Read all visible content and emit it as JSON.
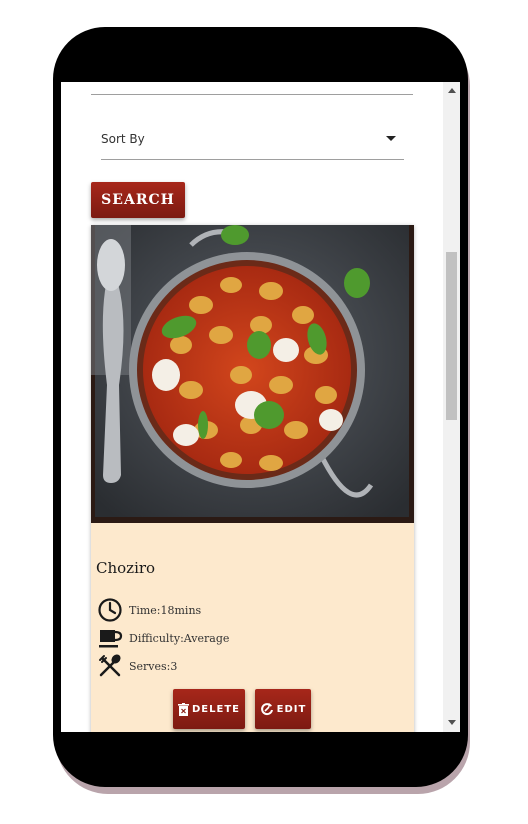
{
  "filters": {
    "sort_label": "Sort By"
  },
  "search": {
    "button_label": "SEARCH"
  },
  "recipe": {
    "title": "Choziro",
    "time": "Time:18mins",
    "difficulty": "Difficulty:Average",
    "serves": "Serves:3",
    "image_icon": "gnocchi-pan-photo",
    "delete_label": "DELETE",
    "edit_label": "EDIT"
  },
  "icons": {
    "time": "clock-icon",
    "difficulty": "cup-icon",
    "serves": "utensils-icon",
    "delete": "trash-icon",
    "edit": "refresh-edit-icon"
  },
  "colors": {
    "accent": "#8b1e14",
    "card_background": "#fde9cd"
  },
  "scroll": {
    "position": 0.35
  }
}
